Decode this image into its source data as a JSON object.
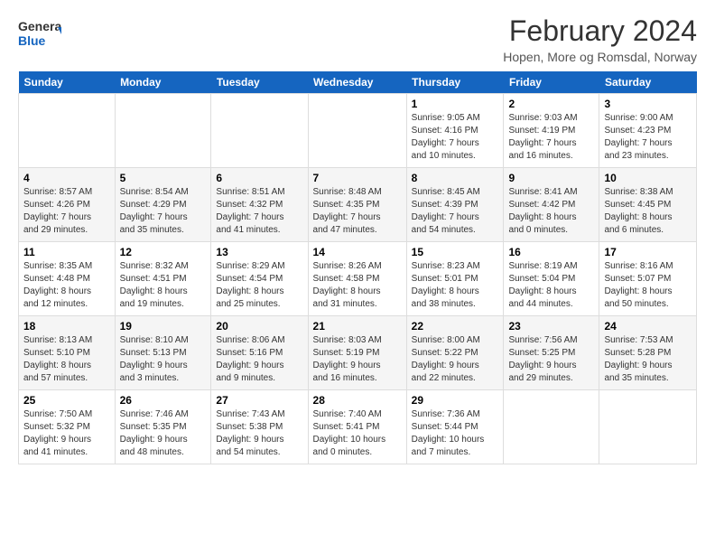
{
  "header": {
    "logo_general": "General",
    "logo_blue": "Blue",
    "title": "February 2024",
    "subtitle": "Hopen, More og Romsdal, Norway"
  },
  "weekdays": [
    "Sunday",
    "Monday",
    "Tuesday",
    "Wednesday",
    "Thursday",
    "Friday",
    "Saturday"
  ],
  "weeks": [
    [
      {
        "day": "",
        "info": ""
      },
      {
        "day": "",
        "info": ""
      },
      {
        "day": "",
        "info": ""
      },
      {
        "day": "",
        "info": ""
      },
      {
        "day": "1",
        "info": "Sunrise: 9:05 AM\nSunset: 4:16 PM\nDaylight: 7 hours\nand 10 minutes."
      },
      {
        "day": "2",
        "info": "Sunrise: 9:03 AM\nSunset: 4:19 PM\nDaylight: 7 hours\nand 16 minutes."
      },
      {
        "day": "3",
        "info": "Sunrise: 9:00 AM\nSunset: 4:23 PM\nDaylight: 7 hours\nand 23 minutes."
      }
    ],
    [
      {
        "day": "4",
        "info": "Sunrise: 8:57 AM\nSunset: 4:26 PM\nDaylight: 7 hours\nand 29 minutes."
      },
      {
        "day": "5",
        "info": "Sunrise: 8:54 AM\nSunset: 4:29 PM\nDaylight: 7 hours\nand 35 minutes."
      },
      {
        "day": "6",
        "info": "Sunrise: 8:51 AM\nSunset: 4:32 PM\nDaylight: 7 hours\nand 41 minutes."
      },
      {
        "day": "7",
        "info": "Sunrise: 8:48 AM\nSunset: 4:35 PM\nDaylight: 7 hours\nand 47 minutes."
      },
      {
        "day": "8",
        "info": "Sunrise: 8:45 AM\nSunset: 4:39 PM\nDaylight: 7 hours\nand 54 minutes."
      },
      {
        "day": "9",
        "info": "Sunrise: 8:41 AM\nSunset: 4:42 PM\nDaylight: 8 hours\nand 0 minutes."
      },
      {
        "day": "10",
        "info": "Sunrise: 8:38 AM\nSunset: 4:45 PM\nDaylight: 8 hours\nand 6 minutes."
      }
    ],
    [
      {
        "day": "11",
        "info": "Sunrise: 8:35 AM\nSunset: 4:48 PM\nDaylight: 8 hours\nand 12 minutes."
      },
      {
        "day": "12",
        "info": "Sunrise: 8:32 AM\nSunset: 4:51 PM\nDaylight: 8 hours\nand 19 minutes."
      },
      {
        "day": "13",
        "info": "Sunrise: 8:29 AM\nSunset: 4:54 PM\nDaylight: 8 hours\nand 25 minutes."
      },
      {
        "day": "14",
        "info": "Sunrise: 8:26 AM\nSunset: 4:58 PM\nDaylight: 8 hours\nand 31 minutes."
      },
      {
        "day": "15",
        "info": "Sunrise: 8:23 AM\nSunset: 5:01 PM\nDaylight: 8 hours\nand 38 minutes."
      },
      {
        "day": "16",
        "info": "Sunrise: 8:19 AM\nSunset: 5:04 PM\nDaylight: 8 hours\nand 44 minutes."
      },
      {
        "day": "17",
        "info": "Sunrise: 8:16 AM\nSunset: 5:07 PM\nDaylight: 8 hours\nand 50 minutes."
      }
    ],
    [
      {
        "day": "18",
        "info": "Sunrise: 8:13 AM\nSunset: 5:10 PM\nDaylight: 8 hours\nand 57 minutes."
      },
      {
        "day": "19",
        "info": "Sunrise: 8:10 AM\nSunset: 5:13 PM\nDaylight: 9 hours\nand 3 minutes."
      },
      {
        "day": "20",
        "info": "Sunrise: 8:06 AM\nSunset: 5:16 PM\nDaylight: 9 hours\nand 9 minutes."
      },
      {
        "day": "21",
        "info": "Sunrise: 8:03 AM\nSunset: 5:19 PM\nDaylight: 9 hours\nand 16 minutes."
      },
      {
        "day": "22",
        "info": "Sunrise: 8:00 AM\nSunset: 5:22 PM\nDaylight: 9 hours\nand 22 minutes."
      },
      {
        "day": "23",
        "info": "Sunrise: 7:56 AM\nSunset: 5:25 PM\nDaylight: 9 hours\nand 29 minutes."
      },
      {
        "day": "24",
        "info": "Sunrise: 7:53 AM\nSunset: 5:28 PM\nDaylight: 9 hours\nand 35 minutes."
      }
    ],
    [
      {
        "day": "25",
        "info": "Sunrise: 7:50 AM\nSunset: 5:32 PM\nDaylight: 9 hours\nand 41 minutes."
      },
      {
        "day": "26",
        "info": "Sunrise: 7:46 AM\nSunset: 5:35 PM\nDaylight: 9 hours\nand 48 minutes."
      },
      {
        "day": "27",
        "info": "Sunrise: 7:43 AM\nSunset: 5:38 PM\nDaylight: 9 hours\nand 54 minutes."
      },
      {
        "day": "28",
        "info": "Sunrise: 7:40 AM\nSunset: 5:41 PM\nDaylight: 10 hours\nand 0 minutes."
      },
      {
        "day": "29",
        "info": "Sunrise: 7:36 AM\nSunset: 5:44 PM\nDaylight: 10 hours\nand 7 minutes."
      },
      {
        "day": "",
        "info": ""
      },
      {
        "day": "",
        "info": ""
      }
    ]
  ]
}
